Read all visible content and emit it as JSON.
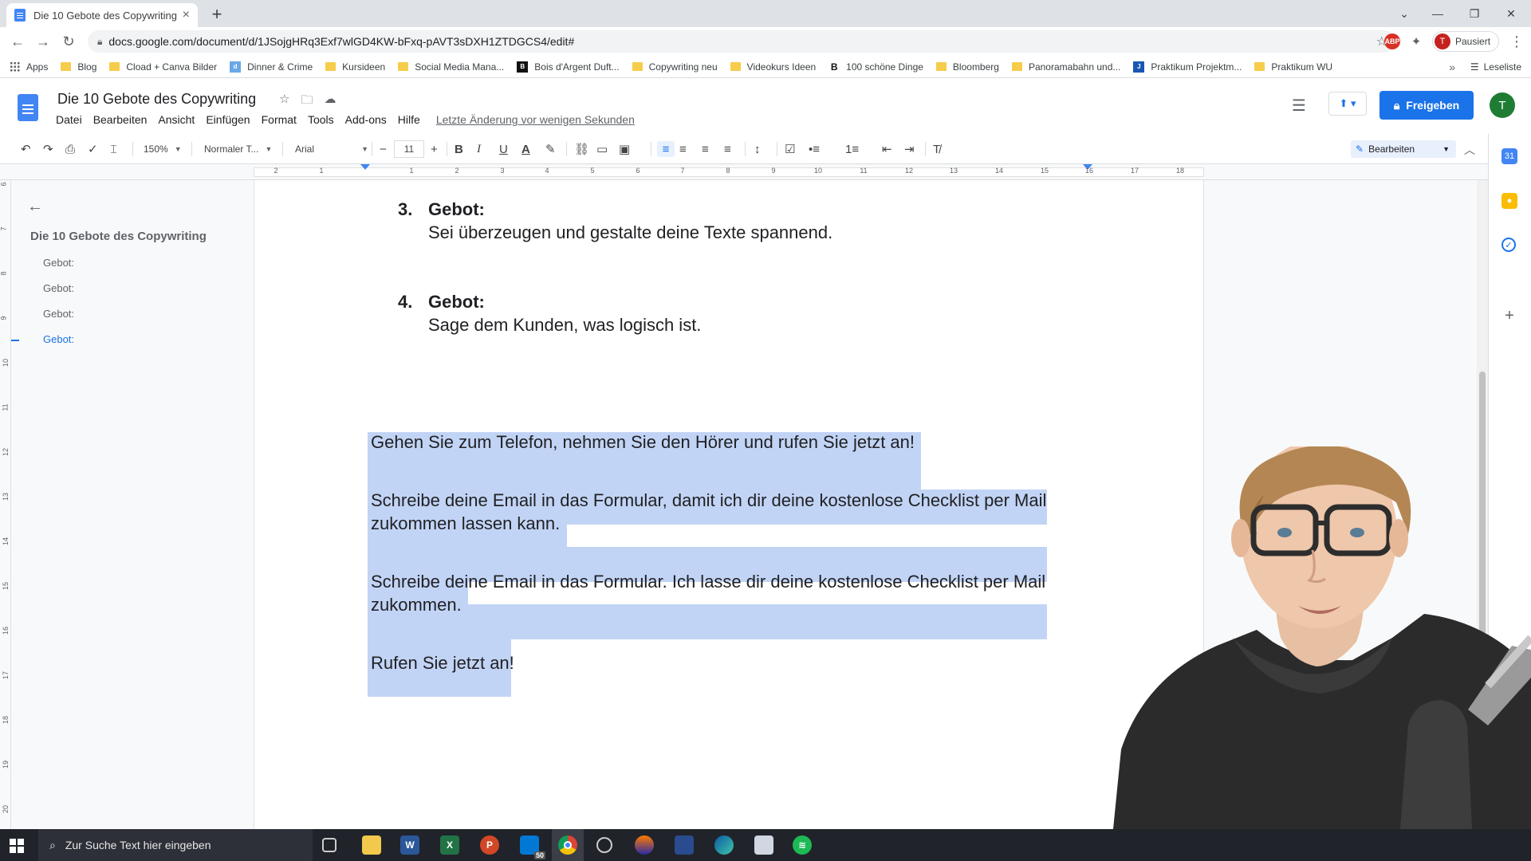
{
  "browser": {
    "tab_title": "Die 10 Gebote des Copywriting",
    "tab_close": "×",
    "new_tab": "+",
    "url": "docs.google.com/document/d/1JSojgHRq3Exf7wlGD4KW-bFxq-pAVT3sDXH1ZTDGCS4/edit#",
    "profile_initial": "T",
    "profile_status": "Pausiert",
    "ext_abp": "ABP",
    "window_controls": [
      "—",
      "❐",
      "✕"
    ],
    "nav": {
      "back": "←",
      "forward": "→",
      "reload": "↻"
    }
  },
  "bookmarks": {
    "items": [
      {
        "label": "Apps",
        "icon": "apps-grid-icon"
      },
      {
        "label": "Blog",
        "icon": "folder-icon"
      },
      {
        "label": "Cload + Canva Bilder",
        "icon": "folder-icon"
      },
      {
        "label": "Dinner & Crime",
        "icon": "site-icon"
      },
      {
        "label": "Kursideen",
        "icon": "folder-icon"
      },
      {
        "label": "Social Media Mana...",
        "icon": "folder-icon"
      },
      {
        "label": "Bois d'Argent Duft...",
        "icon": "site-icon"
      },
      {
        "label": "Copywriting neu",
        "icon": "folder-icon"
      },
      {
        "label": "Videokurs Ideen",
        "icon": "folder-icon"
      },
      {
        "label": "100 schöne Dinge",
        "icon": "site-icon"
      },
      {
        "label": "Bloomberg",
        "icon": "folder-icon"
      },
      {
        "label": "Panoramabahn und...",
        "icon": "folder-icon"
      },
      {
        "label": "Praktikum Projektm...",
        "icon": "site-icon"
      },
      {
        "label": "Praktikum WU",
        "icon": "folder-icon"
      }
    ],
    "more": "»",
    "reading_list": "Leseliste"
  },
  "docs": {
    "title": "Die 10 Gebote des Copywriting",
    "menu": [
      "Datei",
      "Bearbeiten",
      "Ansicht",
      "Einfügen",
      "Format",
      "Tools",
      "Add-ons",
      "Hilfe"
    ],
    "last_edit": "Letzte Änderung vor wenigen Sekunden",
    "share_label": "Freigeben",
    "user_initial": "T"
  },
  "format_toolbar": {
    "zoom": "150%",
    "style": "Normaler T...",
    "font": "Arial",
    "font_size": "11",
    "mode": "Bearbeiten"
  },
  "ruler": {
    "ticks": [
      "2",
      "1",
      "1",
      "2",
      "3",
      "4",
      "5",
      "6",
      "7",
      "8",
      "9",
      "10",
      "11",
      "12",
      "13",
      "14",
      "15",
      "16",
      "17",
      "18"
    ],
    "vticks": [
      "6",
      "7",
      "8",
      "9",
      "10",
      "11",
      "12",
      "13",
      "14",
      "15",
      "16",
      "17",
      "18",
      "19",
      "20"
    ]
  },
  "outline": {
    "title": "Die 10 Gebote des Copywriting",
    "items": [
      "Gebot:",
      "Gebot:",
      "Gebot:",
      "Gebot:"
    ]
  },
  "document": {
    "list_items": [
      {
        "number": "3.",
        "heading": "Gebot:",
        "body": "Sei überzeugen und gestalte deine Texte spannend."
      },
      {
        "number": "4.",
        "heading": "Gebot:",
        "body": "Sage dem Kunden, was logisch ist."
      }
    ],
    "selected_paragraphs": [
      [
        "Gehen Sie zum Telefon, nehmen Sie den Hörer und rufen Sie jetzt an!"
      ],
      [
        "Schreibe deine Email in das Formular, damit ich dir deine kostenlose Checklist per Mail",
        "zukommen lassen kann."
      ],
      [
        "Schreibe deine Email in das Formular. Ich lasse dir deine kostenlose Checklist per Mail",
        "zukommen."
      ],
      [
        "Rufen Sie jetzt an!"
      ]
    ]
  },
  "taskbar": {
    "search_placeholder": "Zur Suche Text hier eingeben",
    "mail_badge": "50"
  },
  "colors": {
    "accent": "#1a73e8",
    "selection": "#c2d4f5",
    "taskbar": "#20232a"
  }
}
